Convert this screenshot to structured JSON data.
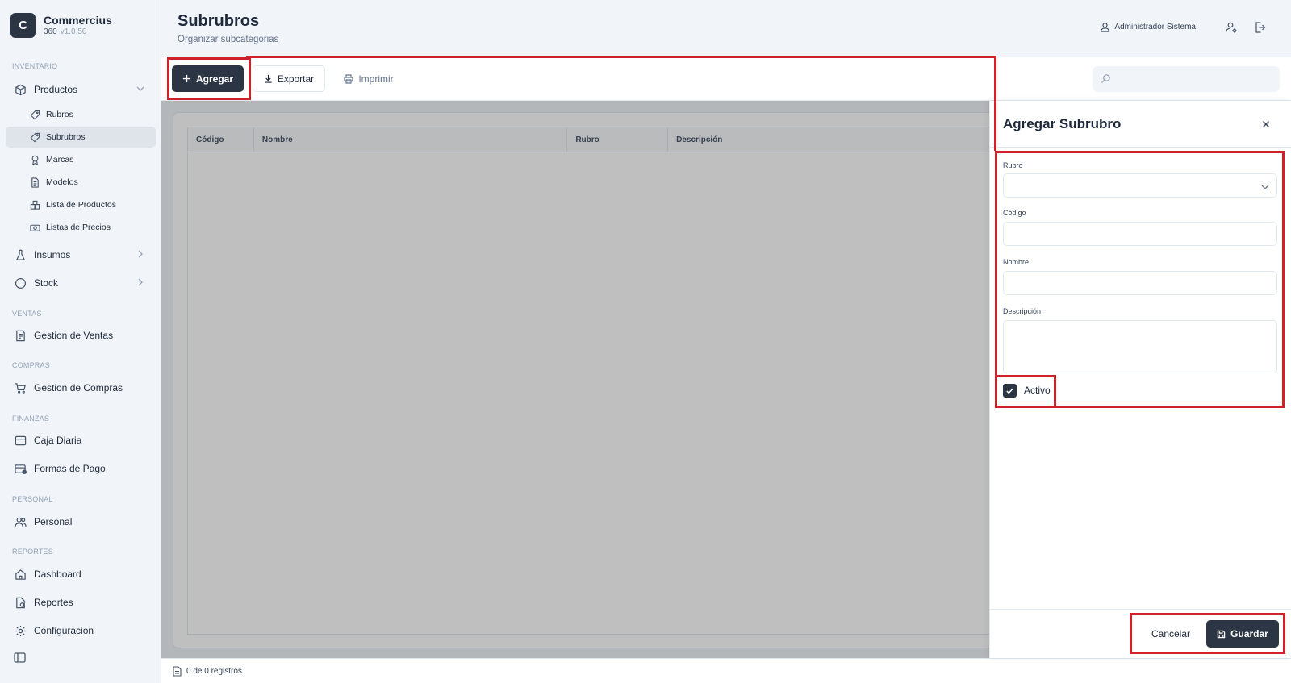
{
  "brand": {
    "logo_letter": "C",
    "name": "Commercius",
    "product": "360",
    "version": "v1.0.50"
  },
  "sidebar": {
    "sections": {
      "inventario": "INVENTARIO",
      "ventas": "VENTAS",
      "compras": "COMPRAS",
      "finanzas": "FINANZAS",
      "personal": "PERSONAL",
      "reportes": "REPORTES"
    },
    "productos": "Productos",
    "sub": {
      "rubros": "Rubros",
      "subrubros": "Subrubros",
      "marcas": "Marcas",
      "modelos": "Modelos",
      "lista_productos": "Lista de Productos",
      "listas_precios": "Listas de Precios"
    },
    "insumos": "Insumos",
    "stock": "Stock",
    "gestion_ventas": "Gestion de Ventas",
    "gestion_compras": "Gestion de Compras",
    "caja_diaria": "Caja Diaria",
    "formas_pago": "Formas de Pago",
    "personal": "Personal",
    "dashboard": "Dashboard",
    "reportes": "Reportes",
    "configuracion": "Configuracion"
  },
  "header": {
    "title": "Subrubros",
    "subtitle": "Organizar subcategorias",
    "user_name": "Administrador Sistema"
  },
  "toolbar": {
    "add_label": "Agregar",
    "export_label": "Exportar",
    "print_label": "Imprimir",
    "search_placeholder": ""
  },
  "table": {
    "columns": [
      "Código",
      "Nombre",
      "Rubro",
      "Descripción"
    ]
  },
  "status": {
    "records": "0 de 0 registros"
  },
  "panel": {
    "title": "Agregar Subrubro",
    "fields": {
      "rubro_label": "Rubro",
      "rubro_value": "",
      "codigo_label": "Código",
      "codigo_value": "",
      "nombre_label": "Nombre",
      "nombre_value": "",
      "descripcion_label": "Descripción",
      "descripcion_value": ""
    },
    "activo_label": "Activo",
    "activo_checked": true,
    "cancel_label": "Cancelar",
    "save_label": "Guardar"
  },
  "colors": {
    "primary": "#2b3544",
    "highlight": "#d0202a",
    "overlay": "rgba(0,0,0,0.25)"
  }
}
